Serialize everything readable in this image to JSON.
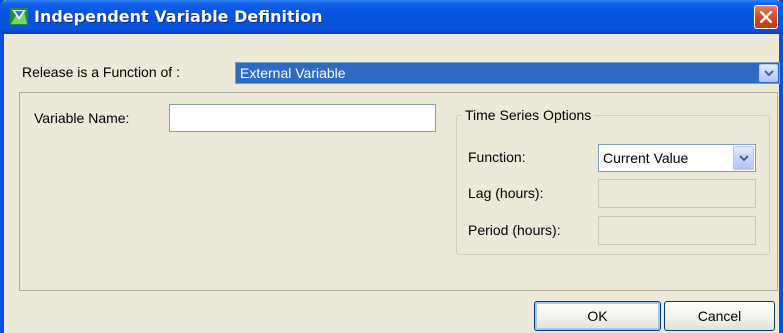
{
  "window": {
    "title": "Independent Variable Definition",
    "close_label": "close"
  },
  "release": {
    "label": "Release is a Function of :",
    "value": "External Variable"
  },
  "variable": {
    "label": "Variable Name:",
    "value": ""
  },
  "time_series": {
    "title": "Time Series Options",
    "function_label": "Function:",
    "function_value": "Current Value",
    "lag_label": "Lag (hours):",
    "lag_value": "",
    "period_label": "Period (hours):",
    "period_value": ""
  },
  "buttons": {
    "ok": "OK",
    "cancel": "Cancel"
  },
  "colors": {
    "titlebar": "#0553E0",
    "selection": "#316AC5",
    "dialog_bg": "#ECE9D8"
  },
  "icons": [
    "app-icon",
    "close-icon",
    "chevron-down-icon"
  ]
}
